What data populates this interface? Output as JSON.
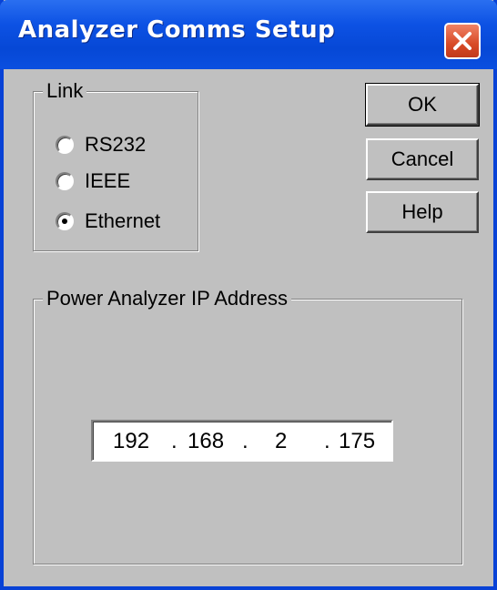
{
  "window": {
    "title": "Analyzer Comms Setup"
  },
  "link_group": {
    "legend": "Link",
    "options": [
      {
        "label": "RS232",
        "checked": false
      },
      {
        "label": "IEEE",
        "checked": false
      },
      {
        "label": "Ethernet",
        "checked": true
      }
    ]
  },
  "buttons": {
    "ok": "OK",
    "cancel": "Cancel",
    "help": "Help"
  },
  "ip_group": {
    "legend": "Power Analyzer IP Address",
    "octets": [
      "192",
      "168",
      "2",
      "175"
    ],
    "separator": "."
  },
  "icons": {
    "close": "close-icon"
  },
  "colors": {
    "titlebar": "#0a4fe0",
    "close_button": "#d84a26",
    "dialog_face": "#c0c0c0"
  }
}
